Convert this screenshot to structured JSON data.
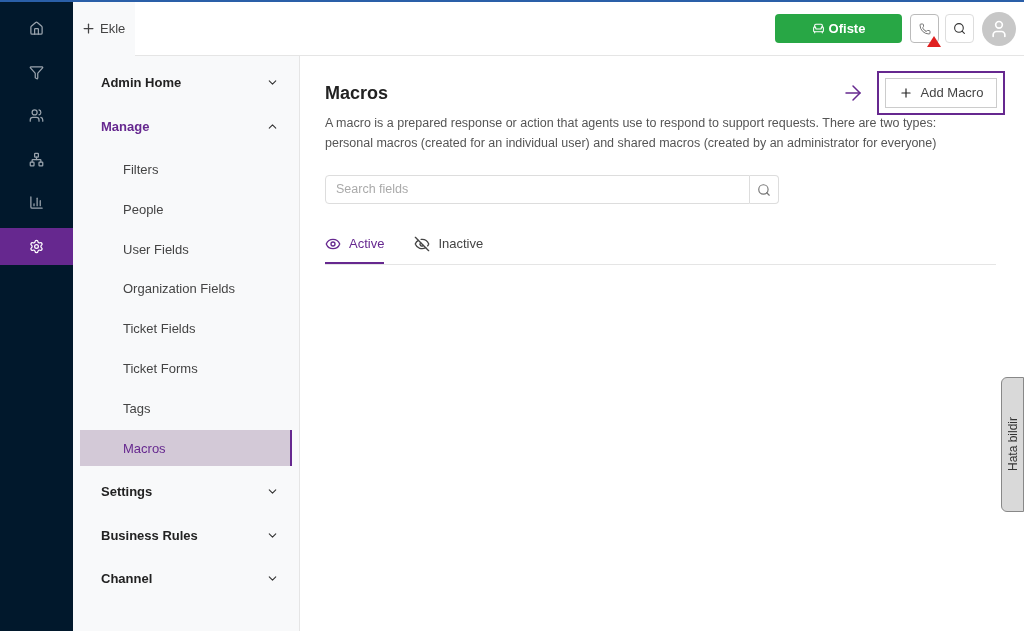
{
  "rail": [
    {
      "kind": "home",
      "selected": false
    },
    {
      "kind": "funnel",
      "selected": false
    },
    {
      "kind": "users",
      "selected": false
    },
    {
      "kind": "hierarchy",
      "selected": false
    },
    {
      "kind": "chart",
      "selected": false
    },
    {
      "kind": "settings",
      "selected": true
    }
  ],
  "topbar": {
    "add_label": "Ekle",
    "status_button": "Ofiste",
    "phone_alert": true
  },
  "sidebar": [
    {
      "label": "Admin Home",
      "expanded": false,
      "selected": false
    },
    {
      "label": "Manage",
      "expanded": true,
      "selected": true,
      "children": [
        {
          "label": "Filters",
          "selected": false
        },
        {
          "label": "People",
          "selected": false
        },
        {
          "label": "User Fields",
          "selected": false
        },
        {
          "label": "Organization Fields",
          "selected": false
        },
        {
          "label": "Ticket Fields",
          "selected": false
        },
        {
          "label": "Ticket Forms",
          "selected": false
        },
        {
          "label": "Tags",
          "selected": false
        },
        {
          "label": "Macros",
          "selected": true
        }
      ]
    },
    {
      "label": "Settings",
      "expanded": false,
      "selected": false
    },
    {
      "label": "Business Rules",
      "expanded": false,
      "selected": false
    },
    {
      "label": "Channel",
      "expanded": false,
      "selected": false
    }
  ],
  "page": {
    "title": "Macros",
    "add_button": "Add Macro",
    "description": "A macro is a prepared response or action that agents use to respond to support requests. There are two types: personal macros (created for an individual user) and shared macros (created by an administrator for everyone)",
    "search": {
      "placeholder": "Search fields"
    },
    "tabs": [
      {
        "label": "Active",
        "kind": "visible",
        "selected": true
      },
      {
        "label": "Inactive",
        "kind": "hidden",
        "selected": false
      }
    ]
  },
  "feedback_tab": "Hata bildir"
}
